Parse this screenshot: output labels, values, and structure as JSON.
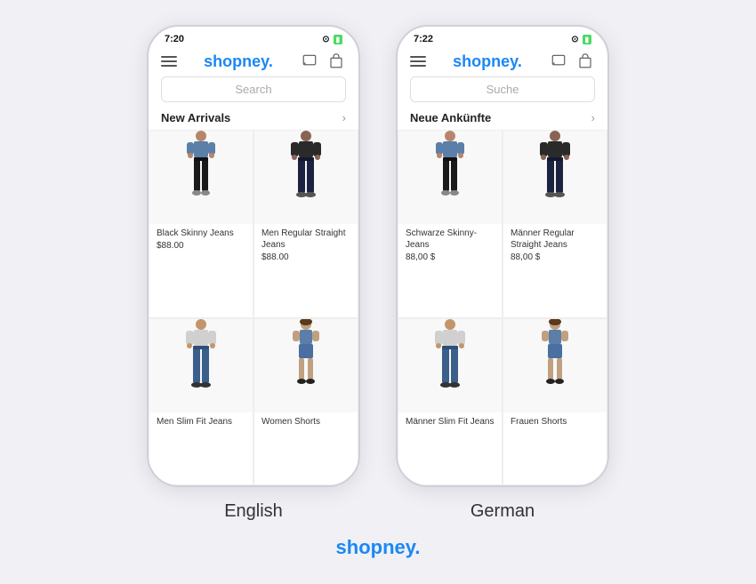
{
  "phones": [
    {
      "id": "english",
      "time": "7:20",
      "language_label": "English",
      "search_placeholder": "Search",
      "section_title": "New Arrivals",
      "products": [
        {
          "name": "Black Skinny Jeans",
          "price": "$88.00",
          "type": "black-skinny-female"
        },
        {
          "name": "Men Regular Straight Jeans",
          "price": "$88.00",
          "type": "black-straight-male"
        },
        {
          "name": "Men Slim Fit Jeans",
          "price": "",
          "type": "blue-slim-male"
        },
        {
          "name": "Women Shorts",
          "price": "",
          "type": "blue-shorts-female"
        }
      ]
    },
    {
      "id": "german",
      "time": "7:22",
      "language_label": "German",
      "search_placeholder": "Suche",
      "section_title": "Neue Ankünfte",
      "products": [
        {
          "name": "Schwarze Skinny-Jeans",
          "price": "88,00 $",
          "type": "black-skinny-female"
        },
        {
          "name": "Männer Regular Straight Jeans",
          "price": "88,00 $",
          "type": "black-straight-male"
        },
        {
          "name": "Männer Slim Fit Jeans",
          "price": "",
          "type": "blue-slim-male"
        },
        {
          "name": "Frauen Shorts",
          "price": "",
          "type": "blue-shorts-female"
        }
      ]
    }
  ],
  "bottom_logo": "shopney.",
  "colors": {
    "brand": "#1a88f5",
    "text_dark": "#222",
    "text_light": "#aaa"
  }
}
